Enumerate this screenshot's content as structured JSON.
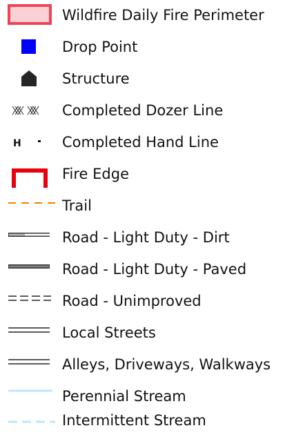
{
  "legend": {
    "items": [
      {
        "label": "Wildfire Daily Fire Perimeter",
        "icon": "fire-perimeter-swatch-icon"
      },
      {
        "label": "Drop Point",
        "icon": "blue-square-icon"
      },
      {
        "label": "Structure",
        "icon": "house-shape-icon"
      },
      {
        "label": "Completed Dozer Line",
        "icon": "dozer-line-icon"
      },
      {
        "label": "Completed Hand Line",
        "icon": "hand-line-icon"
      },
      {
        "label": "Fire Edge",
        "icon": "fire-edge-icon"
      },
      {
        "label": "Trail",
        "icon": "dashed-orange-line-icon"
      },
      {
        "label": "Road - Light Duty - Dirt",
        "icon": "dirt-road-line-icon"
      },
      {
        "label": "Road - Light Duty - Paved",
        "icon": "paved-road-line-icon"
      },
      {
        "label": "Road - Unimproved",
        "icon": "unimproved-road-line-icon"
      },
      {
        "label": "Local Streets",
        "icon": "double-line-icon"
      },
      {
        "label": "Alleys, Driveways, Walkways",
        "icon": "double-line-icon"
      },
      {
        "label": "Perennial Stream",
        "icon": "solid-light-blue-line-icon"
      },
      {
        "label": "Intermittent Stream",
        "icon": "dashed-light-blue-line-icon"
      }
    ],
    "hand_line_glyph": "H",
    "colors": {
      "fire_perimeter_fill": "#f9d1d6",
      "fire_perimeter_border": "#ef4455",
      "drop_point": "#0000ff",
      "structure": "#262626",
      "fire_edge": "#e8000c",
      "trail": "#f57c00",
      "road": "#808080",
      "stream": "#bfe6f7",
      "text": "#111111"
    }
  }
}
